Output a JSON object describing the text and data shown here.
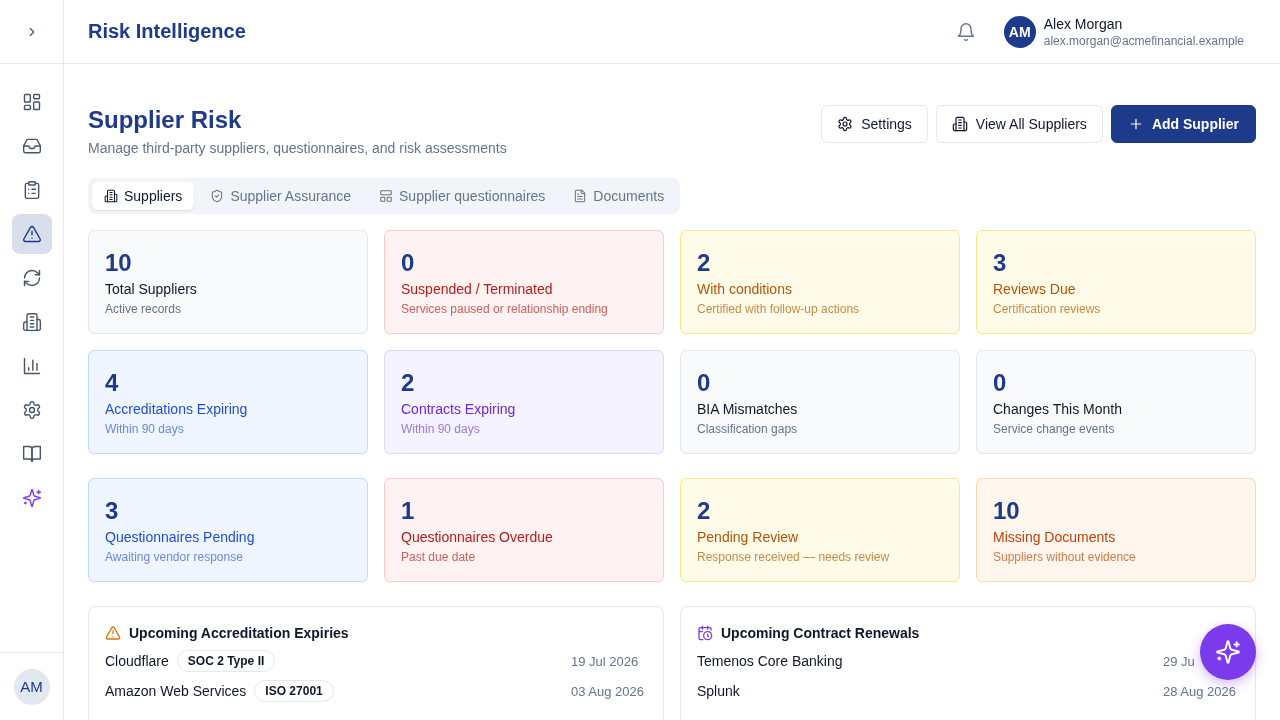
{
  "sidebar": {
    "items": [
      {
        "selected": false
      },
      {
        "selected": false
      },
      {
        "selected": false
      },
      {
        "selected": true
      },
      {
        "selected": false
      },
      {
        "selected": false
      },
      {
        "selected": false
      },
      {
        "selected": false
      },
      {
        "selected": false
      },
      {
        "selected": false
      }
    ],
    "user": {
      "initials": "AM"
    }
  },
  "header": {
    "title": "Risk Intelligence",
    "user": {
      "initials": "AM",
      "name": "Alex Morgan",
      "email": "alex.morgan@acmefinancial.example"
    }
  },
  "page": {
    "title": "Supplier Risk",
    "subtitle": "Manage third-party suppliers, questionnaires, and risk assessments",
    "actions": [
      {
        "label": "Settings",
        "kind": "secondary"
      },
      {
        "label": "View All Suppliers",
        "kind": "secondary"
      },
      {
        "label": "Add Supplier",
        "kind": "primary"
      }
    ]
  },
  "tabs": [
    {
      "label": "Suppliers",
      "selected": true
    },
    {
      "label": "Supplier Assurance",
      "selected": false
    },
    {
      "label": "Supplier questionnaires",
      "selected": false
    },
    {
      "label": "Documents",
      "selected": false
    }
  ],
  "stat_sections": [
    {
      "cards": [
        {
          "value": "10",
          "label": "Total Suppliers",
          "note": "Active records",
          "kind": "neutral"
        },
        {
          "value": "0",
          "label": "Suspended / Terminated",
          "note": "Services paused or relationship ending",
          "kind": "red"
        },
        {
          "value": "2",
          "label": "With conditions",
          "note": "Certified with follow-up actions",
          "kind": "yellow"
        },
        {
          "value": "3",
          "label": "Reviews Due",
          "note": "Certification reviews",
          "kind": "yellow"
        },
        {
          "value": "4",
          "label": "Accreditations Expiring",
          "note": "Within 90 days",
          "kind": "blue"
        },
        {
          "value": "2",
          "label": "Contracts Expiring",
          "note": "Within 90 days",
          "kind": "purple"
        },
        {
          "value": "0",
          "label": "BIA Mismatches",
          "note": "Classification gaps",
          "kind": "neutral"
        },
        {
          "value": "0",
          "label": "Changes This Month",
          "note": "Service change events",
          "kind": "neutral"
        }
      ]
    },
    {
      "cards": [
        {
          "value": "3",
          "label": "Questionnaires Pending",
          "note": "Awaiting vendor response",
          "kind": "blue"
        },
        {
          "value": "1",
          "label": "Questionnaires Overdue",
          "note": "Past due date",
          "kind": "red"
        },
        {
          "value": "2",
          "label": "Pending Review",
          "note": "Response received — needs review",
          "kind": "yellow"
        },
        {
          "value": "10",
          "label": "Missing Documents",
          "note": "Suppliers without evidence",
          "kind": "orange"
        }
      ]
    }
  ],
  "panels": [
    {
      "title": "Upcoming Accreditation Expiries",
      "kind": "accreditations",
      "items": [
        {
          "name": "Cloudflare",
          "tag": "SOC 2 Type II",
          "date": "19 Jul 2026"
        },
        {
          "name": "Amazon Web Services",
          "tag": "ISO 27001",
          "date": "03 Aug 2026"
        }
      ]
    },
    {
      "title": "Upcoming Contract Renewals",
      "kind": "contracts",
      "items": [
        {
          "name": "Temenos Core Banking",
          "date": "29 Ju"
        },
        {
          "name": "Splunk",
          "date": "28 Aug 2026"
        }
      ]
    }
  ],
  "assistant_button": {
    "kind": "fab"
  }
}
